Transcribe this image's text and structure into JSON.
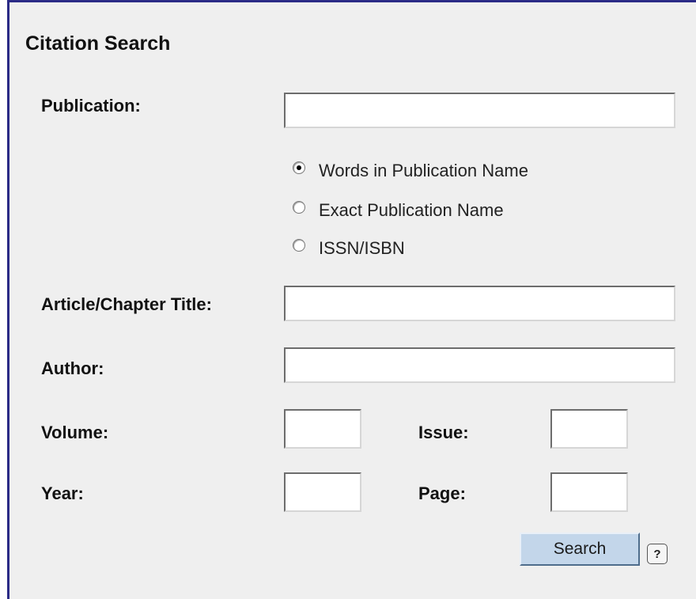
{
  "form": {
    "title": "Citation Search",
    "publication": {
      "label": "Publication:",
      "value": "",
      "options": [
        {
          "label": "Words in Publication Name",
          "checked": true
        },
        {
          "label": "Exact Publication Name",
          "checked": false
        },
        {
          "label": "ISSN/ISBN",
          "checked": false
        }
      ]
    },
    "article_title": {
      "label": "Article/Chapter Title:",
      "value": ""
    },
    "author": {
      "label": "Author:",
      "value": ""
    },
    "volume": {
      "label": "Volume:",
      "value": ""
    },
    "issue": {
      "label": "Issue:",
      "value": ""
    },
    "year": {
      "label": "Year:",
      "value": ""
    },
    "page": {
      "label": "Page:",
      "value": ""
    },
    "search_label": "Search",
    "help_label": "?"
  },
  "colors": {
    "panel_border": "#2b2b86",
    "panel_background": "#efefef",
    "search_button": "#c3d6ea"
  }
}
